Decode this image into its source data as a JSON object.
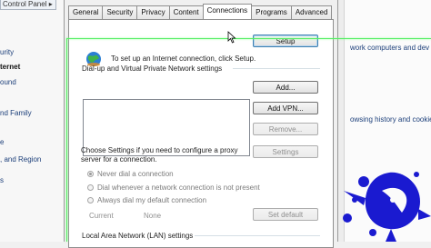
{
  "left_panel": {
    "breadcrumb": "Control Panel ▸",
    "links": [
      {
        "text": "urity",
        "bold": false
      },
      {
        "text": "ternet",
        "bold": true
      },
      {
        "text": "ound",
        "bold": false
      },
      {
        "text": "nd Family",
        "bold": false
      },
      {
        "text": "e",
        "bold": false
      },
      {
        "text": ", and Region",
        "bold": false
      },
      {
        "text": "s",
        "bold": false
      }
    ]
  },
  "right_panel": {
    "text_1": "work computers and dev",
    "text_2": "owsing history and cookies"
  },
  "dialog": {
    "tabs": [
      "General",
      "Security",
      "Privacy",
      "Content",
      "Connections",
      "Programs",
      "Advanced"
    ],
    "active_tab": "Connections",
    "setup_text": "To set up an Internet connection, click Setup.",
    "setup_button": "Setup",
    "dialup_label": "Dial-up and Virtual Private Network settings",
    "add_button": "Add...",
    "add_vpn_button": "Add VPN...",
    "remove_button": "Remove...",
    "choose_text": "Choose Settings if you need to configure a proxy server for a connection.",
    "settings_button": "Settings",
    "radio_never": "Never dial a connection",
    "radio_whenever": "Dial whenever a network connection is not present",
    "radio_always": "Always dial my default connection",
    "current_label": "Current",
    "current_value": "None",
    "set_default_button": "Set default",
    "lan_label": "Local Area Network (LAN) settings"
  },
  "colors": {
    "selection_line": "#55ee66",
    "ink_blue": "#1a1ad0"
  }
}
